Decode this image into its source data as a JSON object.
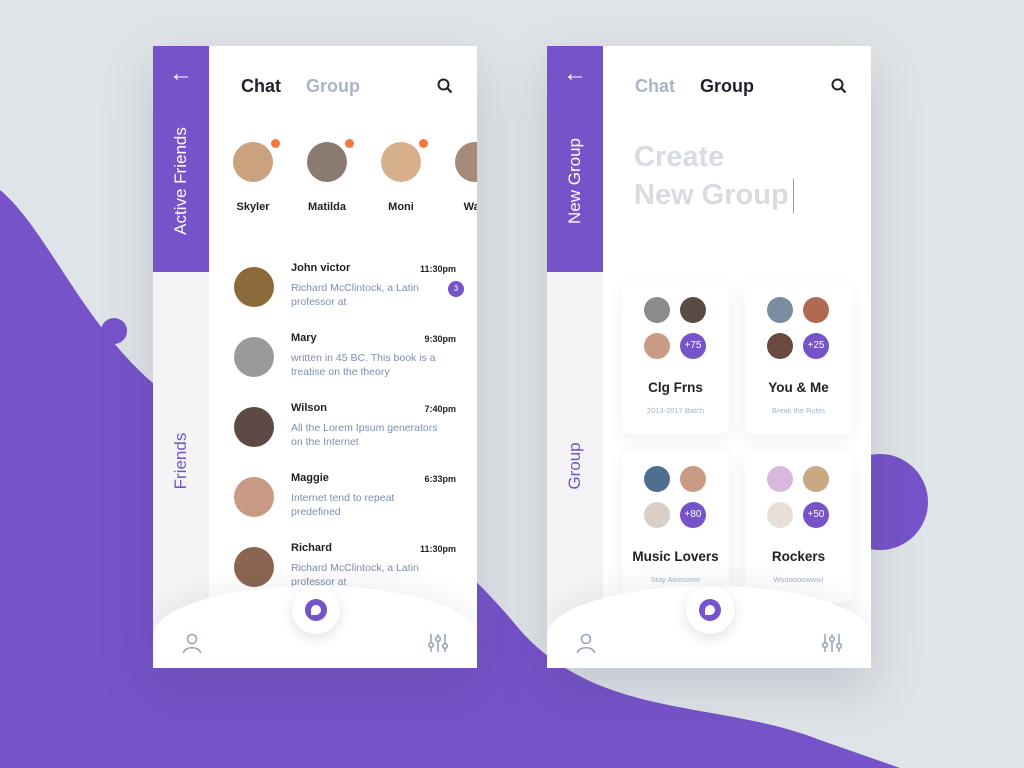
{
  "colors": {
    "accent": "#7653c9",
    "background": "#dfe4e8",
    "online_dot": "#f5763f"
  },
  "chat_screen": {
    "back_icon": "arrow-left-icon",
    "sidebar": {
      "active_label": "Active Friends",
      "secondary_label": "Friends"
    },
    "tabs": [
      {
        "label": "Chat",
        "active": true
      },
      {
        "label": "Group",
        "active": false
      }
    ],
    "active_friends": [
      {
        "name": "Skyler",
        "online": true,
        "color": "#c9a27e"
      },
      {
        "name": "Matilda",
        "online": true,
        "color": "#8a7a72"
      },
      {
        "name": "Moni",
        "online": true,
        "color": "#d6b08a"
      },
      {
        "name": "Walt",
        "online": false,
        "color": "#a58a78"
      }
    ],
    "chats": [
      {
        "name": "John victor",
        "time": "11:30pm",
        "message": "Richard McClintock, a Latin professor at",
        "unread": "3",
        "color": "#8c6a3a"
      },
      {
        "name": "Mary",
        "time": "9:30pm",
        "message": " written in 45 BC. This book is a treatise on the theory",
        "color": "#9a9a9a"
      },
      {
        "name": "Wilson",
        "time": "7:40pm",
        "message": "All the Lorem Ipsum generators on the Internet",
        "color": "#5e4a44"
      },
      {
        "name": "Maggie",
        "time": "6:33pm",
        "message": "Internet tend to repeat predefined",
        "color": "#c99a84"
      },
      {
        "name": "Richard",
        "time": "11:30pm",
        "message": "Richard McClintock, a Latin professor at",
        "color": "#8a6552"
      }
    ]
  },
  "group_screen": {
    "sidebar": {
      "active_label": "New Group",
      "secondary_label": "Group"
    },
    "tabs": [
      {
        "label": "Chat",
        "active": false
      },
      {
        "label": "Group",
        "active": true
      }
    ],
    "create_title_line1": "Create",
    "create_title_line2": "New Group",
    "groups": [
      {
        "name": "Clg Frns",
        "subtitle": "2013-2017 Batch",
        "extra": "+75",
        "colors": [
          "#8b8b8b",
          "#5b4a44",
          "#c99a84"
        ]
      },
      {
        "name": "You & Me",
        "subtitle": "Break the Rules",
        "extra": "+25",
        "colors": [
          "#7a8ca0",
          "#b06a50",
          "#6a4a40"
        ]
      },
      {
        "name": "Music Lovers",
        "subtitle": "Stay Awesome",
        "extra": "+80",
        "colors": [
          "#4e6f8f",
          "#c99a84",
          "#d8cfc8"
        ]
      },
      {
        "name": "Rockers",
        "subtitle": "Woooooowww!",
        "extra": "+50",
        "colors": [
          "#d9b8e0",
          "#c9a882",
          "#e8e0d8"
        ]
      }
    ]
  }
}
